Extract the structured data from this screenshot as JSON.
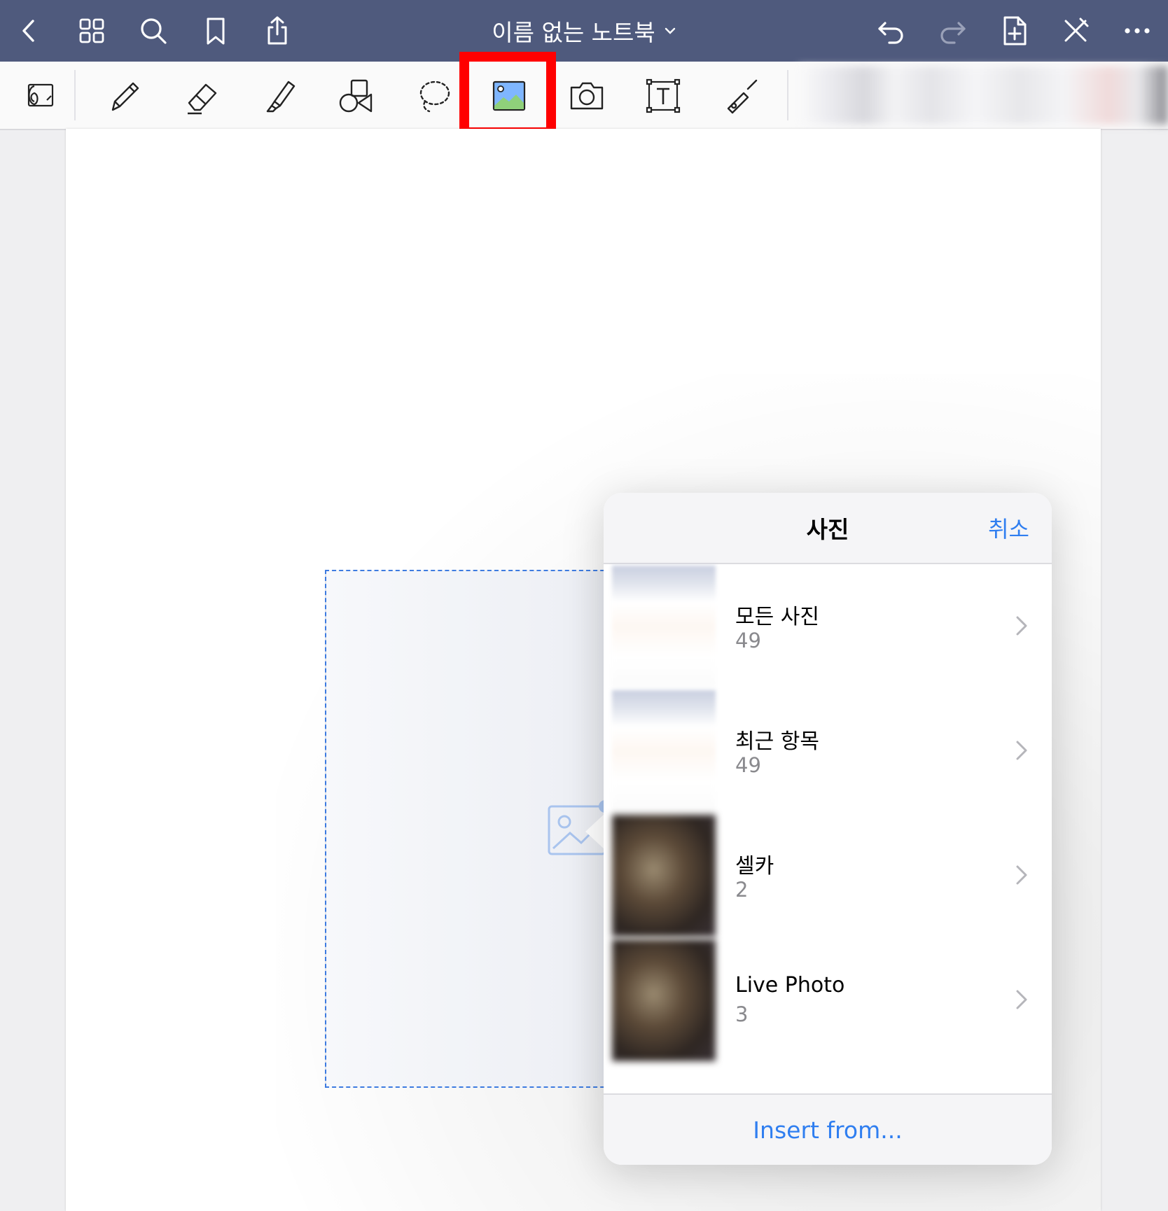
{
  "navbar": {
    "title": "이름 없는 노트북",
    "background_color": "#4f5a7d",
    "left_icons": [
      "back-chevron-icon",
      "grid-icon",
      "search-icon",
      "bookmark-icon",
      "share-icon"
    ],
    "right_icons": [
      "undo-icon",
      "redo-icon",
      "add-page-icon",
      "close-pen-icon",
      "more-icon"
    ]
  },
  "toolbar": {
    "tools": [
      "page-layout-icon",
      "pen-icon",
      "eraser-icon",
      "highlighter-icon",
      "shapes-icon",
      "lasso-icon",
      "image-icon",
      "camera-icon",
      "text-box-icon",
      "laser-pointer-icon"
    ],
    "selected_tool": "image-icon",
    "highlight_color": "#ff0000"
  },
  "popover": {
    "title": "사진",
    "cancel_label": "취소",
    "albums": [
      {
        "name": "모든 사진",
        "count": "49"
      },
      {
        "name": "최근 항목",
        "count": "49"
      },
      {
        "name": "셀카",
        "count": "2"
      },
      {
        "name": "Live Photo",
        "count": "3"
      }
    ],
    "footer_label": "Insert from...",
    "accent_color": "#2f7ef0"
  }
}
